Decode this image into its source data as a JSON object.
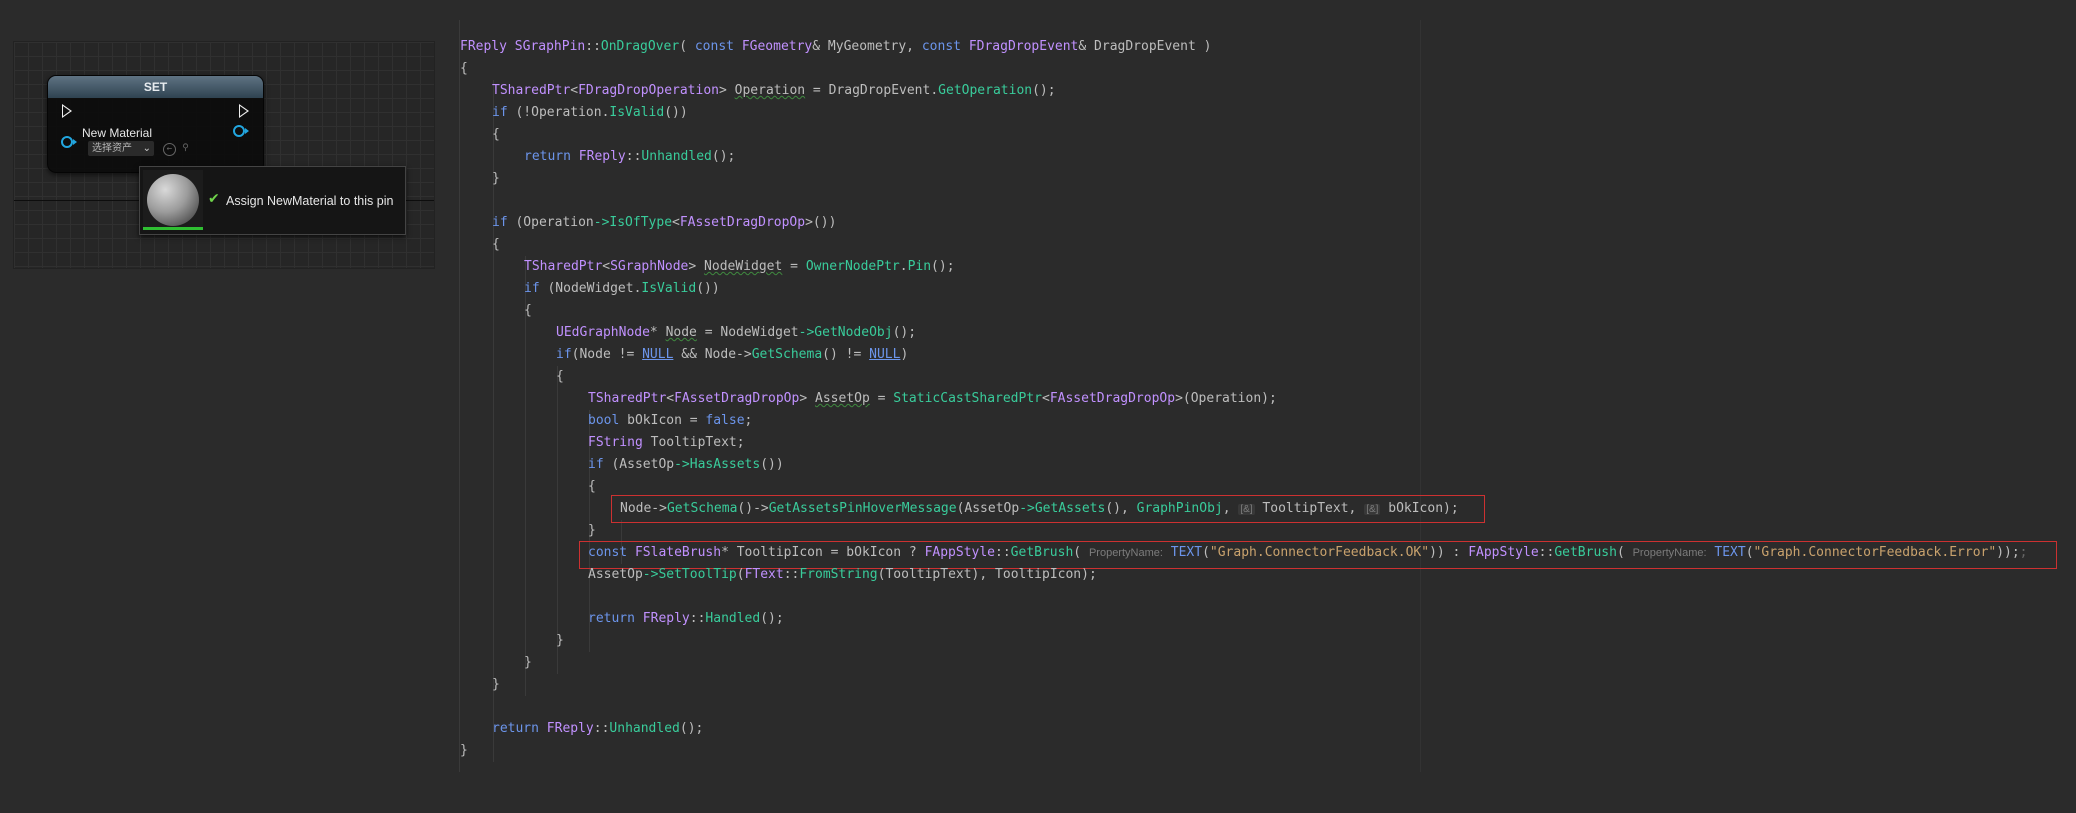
{
  "blueprint": {
    "node_title": "SET",
    "pin_label": "New Material",
    "asset_picker_text": "选择资产",
    "tooltip_text": "Assign NewMaterial to this pin",
    "accent_colors": {
      "pin": "#22a6df",
      "ok_check": "#6fd34b",
      "node_header": "#4f6373"
    }
  },
  "code": {
    "l0": {
      "a": "FReply",
      "b": " ",
      "c": "SGraphPin",
      "d": "::",
      "e": "OnDragOver",
      "f": "( ",
      "g": "const",
      "h": " ",
      "i": "FGeometry",
      "j": "& MyGeometry, ",
      "k": "const",
      "l": " ",
      "m": "FDragDropEvent",
      "n": "& DragDropEvent )"
    },
    "l1": "{",
    "l2": {
      "a": "TSharedPtr",
      "b": "<",
      "c": "FDragDropOperation",
      "d": "> ",
      "e": "Operation",
      "f": " = DragDropEvent.",
      "g": "GetOperation",
      "h": "();"
    },
    "l3": {
      "a": "if",
      "b": " (!Operation.",
      "c": "IsValid",
      "d": "())"
    },
    "l4": "{",
    "l5": {
      "a": "return",
      "b": " ",
      "c": "FReply",
      "d": "::",
      "e": "Unhandled",
      "f": "();"
    },
    "l6": "}",
    "l8": {
      "a": "if",
      "b": " (Operation",
      "c": "->",
      "d": "IsOfType",
      "e": "<",
      "f": "FAssetDragDropOp",
      "g": ">())"
    },
    "l9": "{",
    "l10": {
      "a": "TSharedPtr",
      "b": "<",
      "c": "SGraphNode",
      "d": "> ",
      "e": "NodeWidget",
      "f": " = ",
      "g": "OwnerNodePtr",
      "h": ".",
      "i": "Pin",
      "j": "();"
    },
    "l11": {
      "a": "if",
      "b": " (NodeWidget.",
      "c": "IsValid",
      "d": "())"
    },
    "l12": "{",
    "l13": {
      "a": "UEdGraphNode",
      "b": "* ",
      "c": "Node",
      "d": " = NodeWidget",
      "e": "->",
      "f": "GetNodeObj",
      "g": "();"
    },
    "l14": {
      "a": "if",
      "b": "(Node != ",
      "c": "NULL",
      "d": " && Node->",
      "e": "GetSchema",
      "f": "() != ",
      "g": "NULL",
      "h": ")"
    },
    "l15": "{",
    "l16": {
      "a": "TSharedPtr",
      "b": "<",
      "c": "FAssetDragDropOp",
      "d": "> ",
      "e": "AssetOp",
      "f": " = ",
      "g": "StaticCastSharedPtr",
      "h": "<",
      "i": "FAssetDragDropOp",
      "j": ">(Operation);"
    },
    "l17": {
      "a": "bool",
      "b": " bOkIcon = ",
      "c": "false",
      "d": ";"
    },
    "l18": {
      "a": "FString",
      "b": " TooltipText;"
    },
    "l19": {
      "a": "if",
      "b": " (AssetOp",
      "c": "->",
      "d": "HasAssets",
      "e": "())"
    },
    "l20": "{",
    "l21": {
      "a": "Node->",
      "b": "GetSchema",
      "c": "()->",
      "d": "GetAssetsPinHoverMessage",
      "e": "(AssetOp",
      "f": "->",
      "g": "GetAssets",
      "h": "(), ",
      "i": "GraphPinObj",
      "j": ", ",
      "k": "[&]",
      "l": " TooltipText, ",
      "m": "[&]",
      "n": " bOkIcon);"
    },
    "l22": "}",
    "l23": {
      "a": "const",
      "b": " ",
      "c": "FSlateBrush",
      "d": "* TooltipIcon = bOkIcon ? ",
      "e": "FAppStyle",
      "f": "::",
      "g": "GetBrush",
      "h": "( ",
      "i": "PropertyName:",
      "j": " ",
      "k": "TEXT",
      "l": "(",
      "m": "\"Graph.ConnectorFeedback.OK\"",
      "n": ")) : ",
      "o": "FAppStyle",
      "p": "::",
      "q": "GetBrush",
      "r": "( ",
      "s": "PropertyName:",
      "t": " ",
      "u": "TEXT",
      "v": "(",
      "w": "\"Graph.ConnectorFeedback.Error\"",
      "x": "));",
      "y": ";"
    },
    "l24": {
      "a": "AssetOp",
      "b": "->",
      "c": "SetToolTip",
      "d": "(",
      "e": "FText",
      "f": "::",
      "g": "FromString",
      "h": "(TooltipText), TooltipIcon);"
    },
    "l26": {
      "a": "return",
      "b": " ",
      "c": "FReply",
      "d": "::",
      "e": "Handled",
      "f": "();"
    },
    "l27": "}",
    "l28": "}",
    "l29": "}",
    "l31": {
      "a": "return",
      "b": " ",
      "c": "FReply",
      "d": "::",
      "e": "Unhandled",
      "f": "();"
    },
    "l32": "}"
  }
}
